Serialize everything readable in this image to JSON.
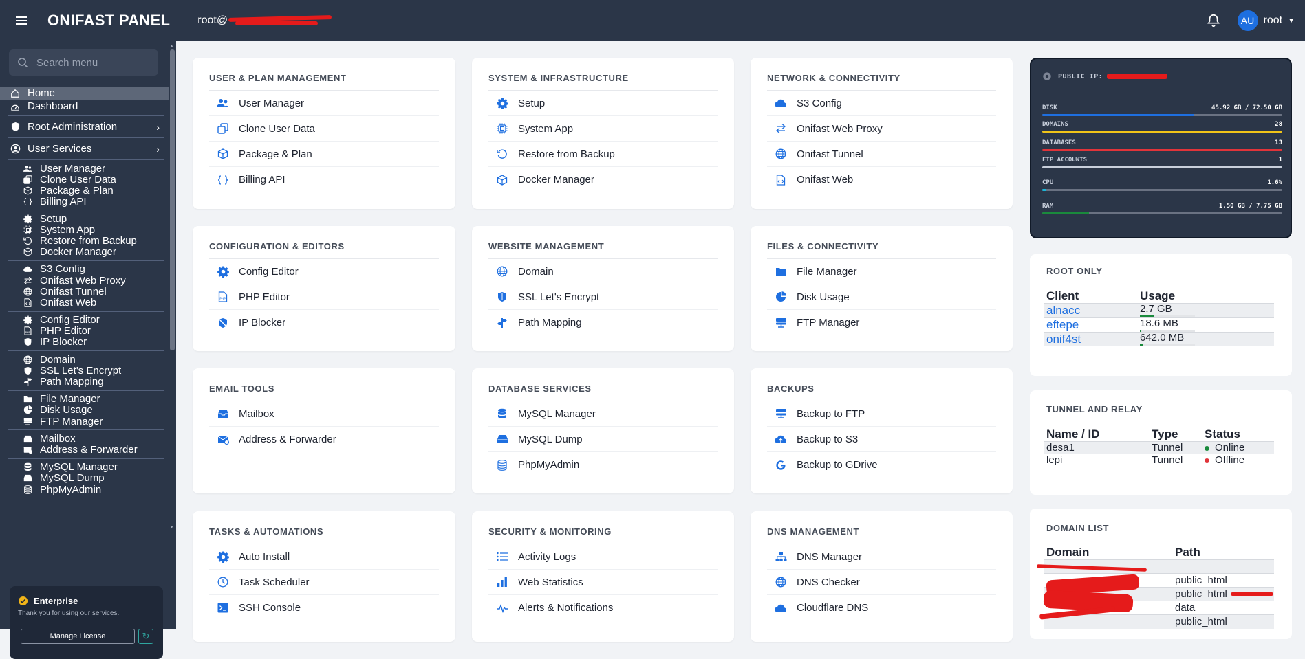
{
  "topbar": {
    "brand": "ONIFAST PANEL",
    "user_host": "root@",
    "avatar": "AU",
    "username": "root"
  },
  "sidebar": {
    "search_placeholder": "Search menu",
    "top": [
      {
        "label": "Home",
        "icon": "home-icon"
      },
      {
        "label": "Dashboard",
        "icon": "dashboard-icon"
      }
    ],
    "sections": [
      {
        "label": "Root Administration",
        "icon": "shield-icon"
      },
      {
        "label": "User Services",
        "icon": "user-circle-icon"
      }
    ],
    "groups": [
      [
        "User Manager",
        "Clone User Data",
        "Package & Plan",
        "Billing API"
      ],
      [
        "Setup",
        "System App",
        "Restore from Backup",
        "Docker Manager"
      ],
      [
        "S3 Config",
        "Onifast Web Proxy",
        "Onifast Tunnel",
        "Onifast Web"
      ],
      [
        "Config Editor",
        "PHP Editor",
        "IP Blocker"
      ],
      [
        "Domain",
        "SSL Let's Encrypt",
        "Path Mapping"
      ],
      [
        "File Manager",
        "Disk Usage",
        "FTP Manager"
      ],
      [
        "Mailbox",
        "Address & Forwarder"
      ],
      [
        "MySQL Manager",
        "MySQL Dump",
        "PhpMyAdmin"
      ]
    ],
    "license": {
      "plan": "Enterprise",
      "message": "Thank you for using our services.",
      "button": "Manage License"
    }
  },
  "cards": [
    {
      "title": "USER & PLAN MANAGEMENT",
      "items": [
        {
          "label": "User Manager",
          "icon": "users-icon"
        },
        {
          "label": "Clone User Data",
          "icon": "copy-icon"
        },
        {
          "label": "Package & Plan",
          "icon": "box-icon"
        },
        {
          "label": "Billing API",
          "icon": "braces-icon"
        }
      ]
    },
    {
      "title": "SYSTEM & INFRASTRUCTURE",
      "items": [
        {
          "label": "Setup",
          "icon": "gear-icon"
        },
        {
          "label": "System App",
          "icon": "chip-icon"
        },
        {
          "label": "Restore from Backup",
          "icon": "restore-icon"
        },
        {
          "label": "Docker Manager",
          "icon": "box-icon"
        }
      ]
    },
    {
      "title": "NETWORK & CONNECTIVITY",
      "items": [
        {
          "label": "S3 Config",
          "icon": "cloud-icon"
        },
        {
          "label": "Onifast Web Proxy",
          "icon": "arrows-icon"
        },
        {
          "label": "Onifast Tunnel",
          "icon": "globe-icon"
        },
        {
          "label": "Onifast Web",
          "icon": "file-code-icon"
        }
      ]
    },
    {
      "title": "CONFIGURATION & EDITORS",
      "items": [
        {
          "label": "Config Editor",
          "icon": "gear-icon"
        },
        {
          "label": "PHP Editor",
          "icon": "php-file-icon"
        },
        {
          "label": "IP Blocker",
          "icon": "shield-slash-icon"
        }
      ]
    },
    {
      "title": "WEBSITE MANAGEMENT",
      "items": [
        {
          "label": "Domain",
          "icon": "globe-icon"
        },
        {
          "label": "SSL Let's Encrypt",
          "icon": "shield-icon"
        },
        {
          "label": "Path Mapping",
          "icon": "signpost-icon"
        }
      ]
    },
    {
      "title": "FILES & CONNECTIVITY",
      "items": [
        {
          "label": "File Manager",
          "icon": "folder-icon"
        },
        {
          "label": "Disk Usage",
          "icon": "pie-icon"
        },
        {
          "label": "FTP Manager",
          "icon": "server-icon"
        }
      ]
    },
    {
      "title": "EMAIL TOOLS",
      "items": [
        {
          "label": "Mailbox",
          "icon": "inbox-icon"
        },
        {
          "label": "Address & Forwarder",
          "icon": "mail-forward-icon"
        }
      ]
    },
    {
      "title": "DATABASE SERVICES",
      "items": [
        {
          "label": "MySQL Manager",
          "icon": "database-icon"
        },
        {
          "label": "MySQL Dump",
          "icon": "hdd-icon"
        },
        {
          "label": "PhpMyAdmin",
          "icon": "database-outline-icon"
        }
      ]
    },
    {
      "title": "BACKUPS",
      "items": [
        {
          "label": "Backup to FTP",
          "icon": "server-icon"
        },
        {
          "label": "Backup to S3",
          "icon": "cloud-upload-icon"
        },
        {
          "label": "Backup to GDrive",
          "icon": "google-icon"
        }
      ]
    },
    {
      "title": "TASKS & AUTOMATIONS",
      "items": [
        {
          "label": "Auto Install",
          "icon": "gear-icon"
        },
        {
          "label": "Task Scheduler",
          "icon": "clock-icon"
        },
        {
          "label": "SSH Console",
          "icon": "terminal-icon"
        }
      ]
    },
    {
      "title": "SECURITY & MONITORING",
      "items": [
        {
          "label": "Activity Logs",
          "icon": "list-icon"
        },
        {
          "label": "Web Statistics",
          "icon": "bar-chart-icon"
        },
        {
          "label": "Alerts & Notifications",
          "icon": "pulse-icon"
        }
      ]
    },
    {
      "title": "DNS MANAGEMENT",
      "items": [
        {
          "label": "DNS Manager",
          "icon": "sitemap-icon"
        },
        {
          "label": "DNS Checker",
          "icon": "globe-icon"
        },
        {
          "label": "Cloudflare DNS",
          "icon": "cloud-icon"
        }
      ]
    }
  ],
  "server": {
    "ip_label": "PUBLIC IP:",
    "stats": [
      {
        "label": "DISK",
        "value": "45.92 GB / 72.50 GB",
        "fraction": 0.633,
        "color": "#1e6fe0"
      },
      {
        "label": "DOMAINS",
        "value": "28",
        "fraction": 1.0,
        "color": "#f0c419"
      },
      {
        "label": "DATABASES",
        "value": "13",
        "fraction": 1.0,
        "color": "#e0343a"
      },
      {
        "label": "FTP ACCOUNTS",
        "value": "1",
        "fraction": 1.0,
        "color": "#c8cfdb"
      },
      {
        "label": "CPU",
        "value": "1.6%",
        "fraction": 0.016,
        "color": "#19b5d6"
      },
      {
        "label": "RAM",
        "value": "1.50 GB / 7.75 GB",
        "fraction": 0.194,
        "color": "#1a8a3c"
      }
    ]
  },
  "root_only": {
    "title": "ROOT ONLY",
    "headers": [
      "Client",
      "Usage"
    ],
    "rows": [
      {
        "client": "alnacc",
        "usage": "2.7 GB",
        "fraction": 0.25
      },
      {
        "client": "eftepe",
        "usage": "18.6 MB",
        "fraction": 0.01
      },
      {
        "client": "onif4st",
        "usage": "642.0 MB",
        "fraction": 0.06
      }
    ]
  },
  "tunnel": {
    "title": "TUNNEL AND RELAY",
    "headers": [
      "Name / ID",
      "Type",
      "Status"
    ],
    "rows": [
      {
        "name": "desa1",
        "type": "Tunnel",
        "status": "Online",
        "color": "#1a8a3c"
      },
      {
        "name": "lepi",
        "type": "Tunnel",
        "status": "Offline",
        "color": "#e0343a"
      }
    ]
  },
  "domains": {
    "title": "DOMAIN LIST",
    "headers": [
      "Domain",
      "Path"
    ],
    "rows": [
      {
        "path": ""
      },
      {
        "path": "public_html"
      },
      {
        "path": "public_html"
      },
      {
        "path": "data"
      },
      {
        "path": "public_html"
      }
    ]
  }
}
